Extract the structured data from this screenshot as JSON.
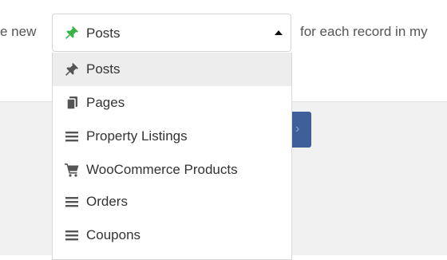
{
  "sentence": {
    "before": "e new",
    "after": "for each record in my"
  },
  "select": {
    "selected_label": "Posts",
    "selected_icon": "pin-icon",
    "pin_color": "#3bb34a"
  },
  "dropdown": {
    "items": [
      {
        "label": "Posts",
        "icon": "pin-icon",
        "selected": true
      },
      {
        "label": "Pages",
        "icon": "pages-icon",
        "selected": false
      },
      {
        "label": "Property Listings",
        "icon": "menu-lines-icon",
        "selected": false
      },
      {
        "label": "WooCommerce Products",
        "icon": "cart-icon",
        "selected": false
      },
      {
        "label": "Orders",
        "icon": "menu-lines-icon",
        "selected": false
      },
      {
        "label": "Coupons",
        "icon": "menu-lines-icon",
        "selected": false
      }
    ]
  },
  "next_button": {
    "glyph": "›",
    "color": "#3e5f9a"
  }
}
